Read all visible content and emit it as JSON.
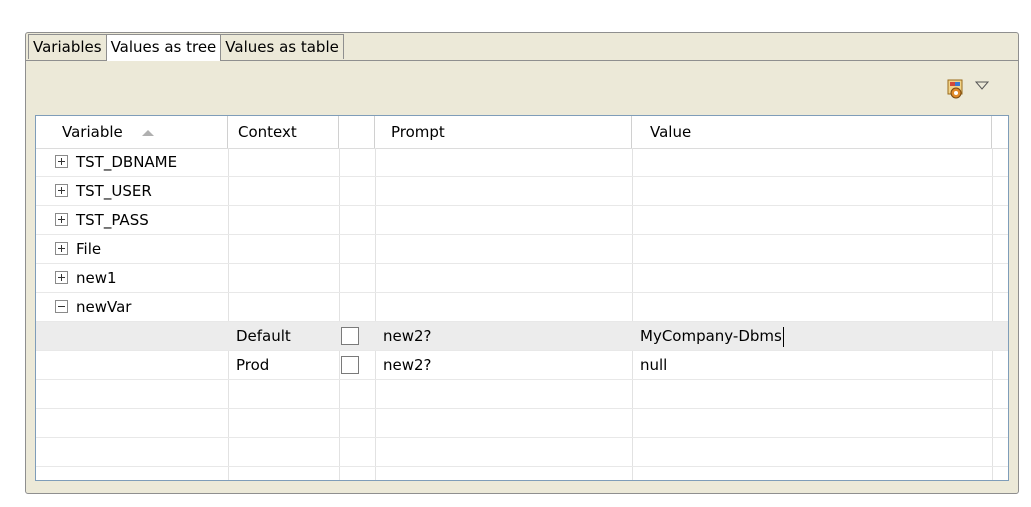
{
  "tabs": [
    {
      "label": "Variables",
      "active": false
    },
    {
      "label": "Values as tree",
      "active": true
    },
    {
      "label": "Values as table",
      "active": false
    }
  ],
  "toolbar": {
    "icon": "context-settings-icon",
    "menu_icon": "view-menu-chevron-icon"
  },
  "table": {
    "columns": [
      "Variable",
      "Context",
      "",
      "Prompt",
      "Value"
    ],
    "sort_column": "Variable",
    "rows": [
      {
        "variable": "TST_DBNAME",
        "expanded": false
      },
      {
        "variable": "TST_USER",
        "expanded": false
      },
      {
        "variable": "TST_PASS",
        "expanded": false
      },
      {
        "variable": "File",
        "expanded": false
      },
      {
        "variable": "new1",
        "expanded": false
      },
      {
        "variable": "newVar",
        "expanded": true
      }
    ],
    "children": [
      {
        "context": "Default",
        "checked": false,
        "prompt": "new2?",
        "value": "MyCompany-Dbms",
        "selected": true
      },
      {
        "context": "Prod",
        "checked": false,
        "prompt": "new2?",
        "value": "null",
        "selected": false
      }
    ]
  }
}
